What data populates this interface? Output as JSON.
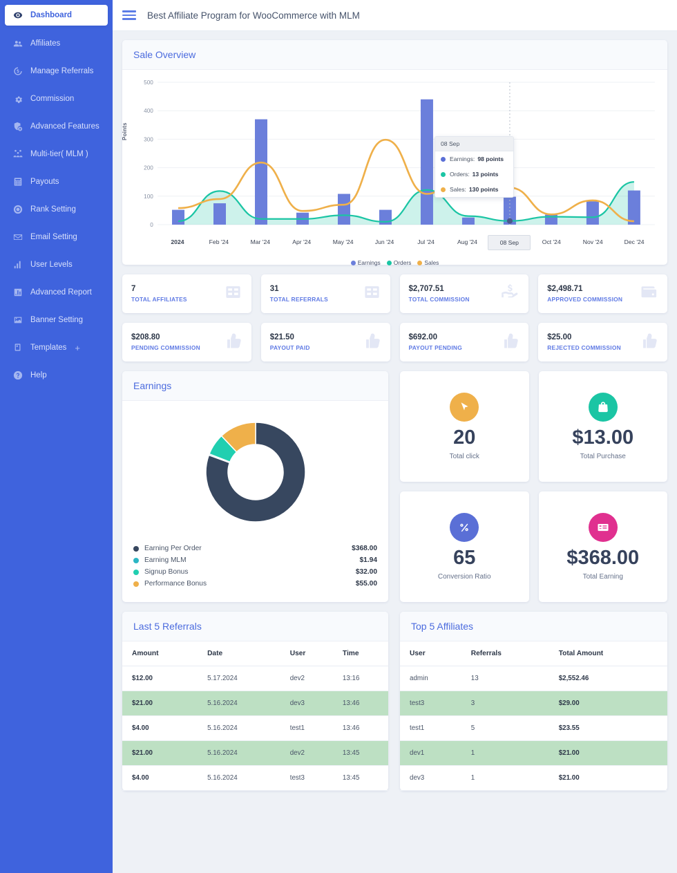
{
  "sidebar": {
    "items": [
      {
        "label": "Dashboard",
        "icon": "eye-icon",
        "active": true
      },
      {
        "label": "Affiliates",
        "icon": "users-icon",
        "active": false
      },
      {
        "label": "Manage Referrals",
        "icon": "refresh-dollar-icon",
        "active": false
      },
      {
        "label": "Commission",
        "icon": "gear-icon",
        "active": false
      },
      {
        "label": "Advanced Features",
        "icon": "shield-plus-icon",
        "active": false
      },
      {
        "label": "Multi-tier( MLM )",
        "icon": "network-icon",
        "active": false
      },
      {
        "label": "Payouts",
        "icon": "calculator-icon",
        "active": false
      },
      {
        "label": "Rank Setting",
        "icon": "badge-icon",
        "active": false
      },
      {
        "label": "Email Setting",
        "icon": "envelope-icon",
        "active": false
      },
      {
        "label": "User Levels",
        "icon": "bar-chart-icon",
        "active": false
      },
      {
        "label": "Advanced Report",
        "icon": "report-icon",
        "active": false
      },
      {
        "label": "Banner Setting",
        "icon": "image-icon",
        "active": false
      },
      {
        "label": "Templates",
        "icon": "template-icon",
        "active": false,
        "expander": "+"
      },
      {
        "label": "Help",
        "icon": "question-icon",
        "active": false
      }
    ]
  },
  "header": {
    "title": "Best Affiliate Program for WooCommerce with MLM",
    "menu_icon": "hamburger-icon"
  },
  "sale_overview": {
    "title": "Sale Overview",
    "tooltip": {
      "date": "08 Sep",
      "rows": [
        {
          "label": "Earnings:",
          "value": "98 points",
          "color": "#5a6fd6"
        },
        {
          "label": "Orders:",
          "value": "13 points",
          "color": "#1bc5a4"
        },
        {
          "label": "Sales:",
          "value": "130 points",
          "color": "#efb04a"
        }
      ]
    }
  },
  "chart_data": {
    "type": "bar",
    "title": "Sale Overview",
    "xlabel": "",
    "ylabel": "Points",
    "ylim": [
      0,
      500
    ],
    "yticks": [
      0,
      100,
      200,
      300,
      400,
      500
    ],
    "grid": true,
    "legend_position": "bottom",
    "categories": [
      "2024",
      "Feb '24",
      "Mar '24",
      "Apr '24",
      "May '24",
      "Jun '24",
      "Jul '24",
      "Aug '24",
      "08 Sep",
      "Oct '24",
      "Nov '24",
      "Dec '24"
    ],
    "highlighted_category": "08 Sep",
    "series": [
      {
        "name": "Earnings",
        "type": "bar",
        "color": "#6b7fdb",
        "values": [
          52,
          75,
          370,
          42,
          108,
          52,
          440,
          25,
          98,
          35,
          82,
          120
        ]
      },
      {
        "name": "Orders",
        "type": "area",
        "color": "#1bc5a4",
        "values": [
          12,
          118,
          20,
          20,
          33,
          10,
          122,
          30,
          13,
          28,
          26,
          150
        ]
      },
      {
        "name": "Sales",
        "type": "line",
        "color": "#efb04a",
        "values": [
          58,
          90,
          218,
          48,
          70,
          298,
          108,
          210,
          130,
          36,
          85,
          12
        ]
      }
    ]
  },
  "stats_row1": [
    {
      "value": "7",
      "label": "TOTAL AFFILIATES",
      "icon": "grid-icon"
    },
    {
      "value": "31",
      "label": "TOTAL REFERRALS",
      "icon": "grid-icon"
    },
    {
      "value": "$2,707.51",
      "label": "TOTAL COMMISSION",
      "icon": "hand-dollar-icon"
    },
    {
      "value": "$2,498.71",
      "label": "APPROVED COMMISSION",
      "icon": "wallet-icon"
    }
  ],
  "stats_row2": [
    {
      "value": "$208.80",
      "label": "PENDING COMMISSION",
      "icon": "thumbs-up-icon"
    },
    {
      "value": "$21.50",
      "label": "PAYOUT PAID",
      "icon": "thumbs-up-icon"
    },
    {
      "value": "$692.00",
      "label": "PAYOUT PENDING",
      "icon": "thumbs-up-icon"
    },
    {
      "value": "$25.00",
      "label": "REJECTED COMMISSION",
      "icon": "thumbs-up-icon"
    }
  ],
  "earnings": {
    "title": "Earnings",
    "donut": {
      "type": "pie",
      "title": "Earnings",
      "labels": [
        "Earning Per Order",
        "Earning MLM",
        "Signup Bonus",
        "Performance Bonus"
      ],
      "values": [
        368.0,
        1.94,
        32.0,
        55.0
      ],
      "display_values": [
        "$368.00",
        "$1.94",
        "$32.00",
        "$55.00"
      ],
      "colors": [
        "#37475f",
        "#2cb6c4",
        "#21cfb0",
        "#efb04a"
      ]
    }
  },
  "metrics": [
    {
      "value": "20",
      "caption": "Total click",
      "icon": "cursor-icon",
      "color": "#efb04a"
    },
    {
      "value": "$13.00",
      "caption": "Total Purchase",
      "icon": "bag-icon",
      "color": "#1bc5a4"
    },
    {
      "value": "65",
      "caption": "Conversion Ratio",
      "icon": "percent-icon",
      "color": "#5a6fd6"
    },
    {
      "value": "$368.00",
      "caption": "Total Earning",
      "icon": "card-icon",
      "color": "#e0308f"
    }
  ],
  "last_referrals": {
    "title": "Last 5 Referrals",
    "columns": [
      "Amount",
      "Date",
      "User",
      "Time"
    ],
    "rows": [
      [
        "$12.00",
        "5.17.2024",
        "dev2",
        "13:16"
      ],
      [
        "$21.00",
        "5.16.2024",
        "dev3",
        "13:46"
      ],
      [
        "$4.00",
        "5.16.2024",
        "test1",
        "13:46"
      ],
      [
        "$21.00",
        "5.16.2024",
        "dev2",
        "13:45"
      ],
      [
        "$4.00",
        "5.16.2024",
        "test3",
        "13:45"
      ]
    ]
  },
  "top_affiliates": {
    "title": "Top 5 Affiliates",
    "columns": [
      "User",
      "Referrals",
      "Total Amount"
    ],
    "rows": [
      [
        "admin",
        "13",
        "$2,552.46"
      ],
      [
        "test3",
        "3",
        "$29.00"
      ],
      [
        "test1",
        "5",
        "$23.55"
      ],
      [
        "dev1",
        "1",
        "$21.00"
      ],
      [
        "dev3",
        "1",
        "$21.00"
      ]
    ]
  }
}
